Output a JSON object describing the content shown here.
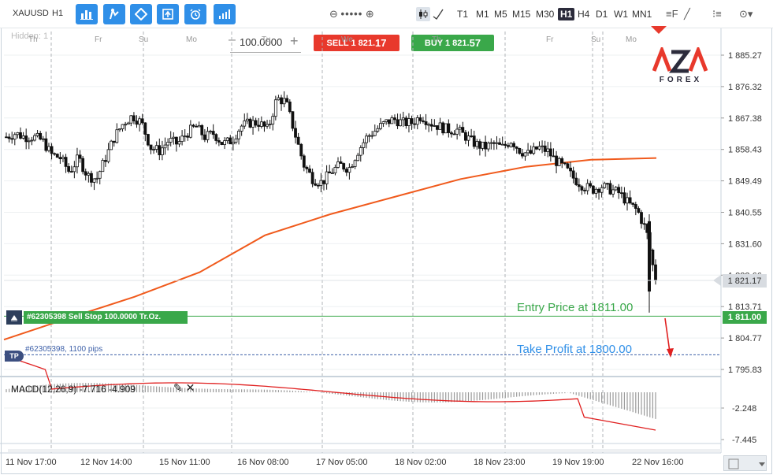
{
  "toolbar": {
    "symbol": "XAUUSD",
    "period": "H1",
    "buttons": [
      "bar-chart-icon",
      "indicators-icon",
      "objects-icon",
      "template-icon",
      "alarm-icon",
      "signals-icon"
    ],
    "zoom_minus": "⊖",
    "zoom_dots": "•••••",
    "zoom_plus": "⊕",
    "timeframes": [
      "T1",
      "M1",
      "M5",
      "M15",
      "M30",
      "H1",
      "H4",
      "D1",
      "W1",
      "MN1"
    ],
    "active_timeframe": "H1",
    "tools": [
      "≡F",
      "╱",
      "⁝≡",
      "⊙▾"
    ]
  },
  "trade": {
    "quantity_minus": "–",
    "quantity": "100.0000",
    "quantity_plus": "+",
    "sell_prefix": "SELL 1 821.",
    "sell_big": "17",
    "buy_prefix": "BUY 1 821.",
    "buy_big": "57"
  },
  "hidden_label": "Hidden: 1",
  "logo": {
    "top": "AZA",
    "bottom": "FOREX"
  },
  "position": {
    "label": "#62305398 Sell Stop 100.0000 Tr.Oz.",
    "tp_icon": "TP",
    "tp_label": "#62305398, 1100 pips",
    "entry_badge": "1 811.00",
    "current_badge": "1 821.17"
  },
  "annotations": {
    "entry": "Entry Price at 1811.00",
    "take_profit": "Take Profit at 1800.00"
  },
  "macd": {
    "label": "MACD(12,26,9) -7.716 -4.909",
    "tools": "✎ ✕"
  },
  "colors": {
    "candle": "#111111",
    "ma": "#f05a1c",
    "entry": "#3aa84a",
    "take_profit": "#3c5fa8",
    "macd_signal": "#e02020",
    "macd_hist": "#9a9a9a",
    "sell": "#e8392c",
    "buy": "#3aa84a",
    "arrow": "#e02020"
  },
  "chart_data": {
    "type": "candlestick",
    "symbol": "XAUUSD",
    "timeframe": "H1",
    "y_ticks": [
      "1 885.27",
      "1 876.32",
      "1 867.38",
      "1 858.43",
      "1 849.49",
      "1 840.55",
      "1 831.60",
      "1 822.66",
      "1 813.71",
      "1 804.77",
      "1 795.83"
    ],
    "ylim": [
      1795.83,
      1885.27
    ],
    "x_ticks": [
      "11 Nov 17:00",
      "12 Nov 14:00",
      "15 Nov 11:00",
      "16 Nov 08:00",
      "17 Nov 05:00",
      "18 Nov 02:00",
      "18 Nov 23:00",
      "19 Nov 19:00",
      "22 Nov 16:00"
    ],
    "day_labels": [
      "Th",
      "Fr",
      "Su",
      "Mo",
      "Tu",
      "We",
      "Th",
      "Fr",
      "Su",
      "Mo"
    ],
    "close_path": [
      1862,
      1863,
      1862,
      1862,
      1861,
      1857,
      1856,
      1852,
      1856,
      1851,
      1850,
      1856,
      1862,
      1866,
      1868,
      1866,
      1859,
      1858,
      1861,
      1860,
      1863,
      1865,
      1862,
      1863,
      1860,
      1861,
      1865,
      1866,
      1866,
      1864,
      1873,
      1872,
      1863,
      1854,
      1850,
      1849,
      1852,
      1854,
      1853,
      1858,
      1862,
      1864,
      1866,
      1867,
      1866,
      1866,
      1868,
      1866,
      1865,
      1864,
      1864,
      1862,
      1860,
      1859,
      1860,
      1859,
      1861,
      1858,
      1857,
      1859,
      1858,
      1855,
      1853,
      1850,
      1848,
      1847,
      1848,
      1847,
      1846,
      1843,
      1841,
      1835,
      1821
    ],
    "moving_average": [
      {
        "t": 0,
        "v": 1804.3
      },
      {
        "t": 0.1,
        "v": 1810.5
      },
      {
        "t": 0.2,
        "v": 1816.5
      },
      {
        "t": 0.3,
        "v": 1823.5
      },
      {
        "t": 0.4,
        "v": 1834
      },
      {
        "t": 0.5,
        "v": 1840
      },
      {
        "t": 0.6,
        "v": 1845
      },
      {
        "t": 0.7,
        "v": 1850
      },
      {
        "t": 0.8,
        "v": 1853.5
      },
      {
        "t": 0.9,
        "v": 1855.5
      },
      {
        "t": 1.0,
        "v": 1856
      }
    ],
    "entry_price": 1811.0,
    "take_profit": 1800.0,
    "current_price": 1821.17,
    "macd": {
      "params": "12,26,9",
      "macd_value": -7.716,
      "signal_value": -4.909,
      "y_ticks": [
        "-2.248",
        "-7.445"
      ]
    }
  }
}
